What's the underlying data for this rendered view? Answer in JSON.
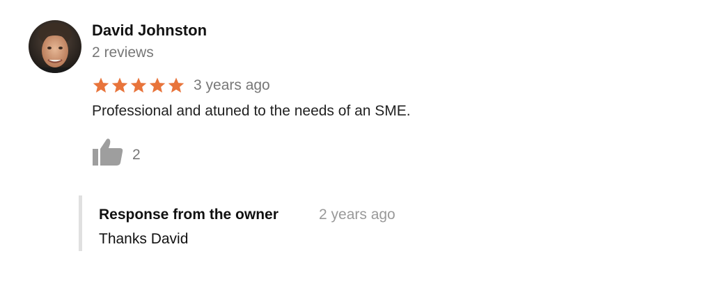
{
  "review": {
    "reviewer_name": "David Johnston",
    "review_count": "2 reviews",
    "rating": 5,
    "rating_max": 5,
    "star_color": "#e8743b",
    "date": "3 years ago",
    "text": "Professional and atuned to the needs of an SME.",
    "likes": "2",
    "avatar_icon": "person-avatar"
  },
  "owner_response": {
    "title": "Response from the owner",
    "date": "2 years ago",
    "text": "Thanks David"
  },
  "icons": {
    "like": "thumbs-up-icon",
    "star": "star-icon"
  }
}
